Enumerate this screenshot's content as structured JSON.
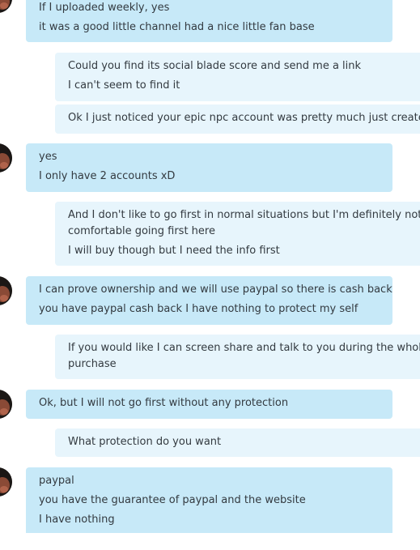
{
  "messages": [
    {
      "side": "in",
      "lines": [
        "If I uploaded weekly, yes",
        "it was a good little channel had a nice little fan base"
      ]
    },
    {
      "side": "out",
      "lines": [
        "Could you find its social blade score and send me a link",
        "I can't seem to find it"
      ]
    },
    {
      "side": "out",
      "lines": [
        "Ok I just noticed your epic npc account was pretty much just created."
      ]
    },
    {
      "side": "in",
      "lines": [
        "yes",
        "I only have 2 accounts xD"
      ]
    },
    {
      "side": "out",
      "lines": [
        "And I don't like to go first in normal situations but I'm definitely not",
        "comfortable going first here",
        "I will buy though but I need the info first"
      ]
    },
    {
      "side": "in",
      "lines": [
        "I can prove ownership and we will use paypal so there is cash back",
        "you have paypal cash back I have nothing to protect my self"
      ]
    },
    {
      "side": "out",
      "lines": [
        "If you would like I can screen share and talk to you during the whole",
        "purchase"
      ]
    },
    {
      "side": "in",
      "lines": [
        "Ok, but I will not go first without any protection"
      ]
    },
    {
      "side": "out",
      "lines": [
        "What protection do you want"
      ]
    },
    {
      "side": "in",
      "lines": [
        "paypal",
        "you have the guarantee of paypal and the website",
        "I have nothing"
      ]
    }
  ]
}
